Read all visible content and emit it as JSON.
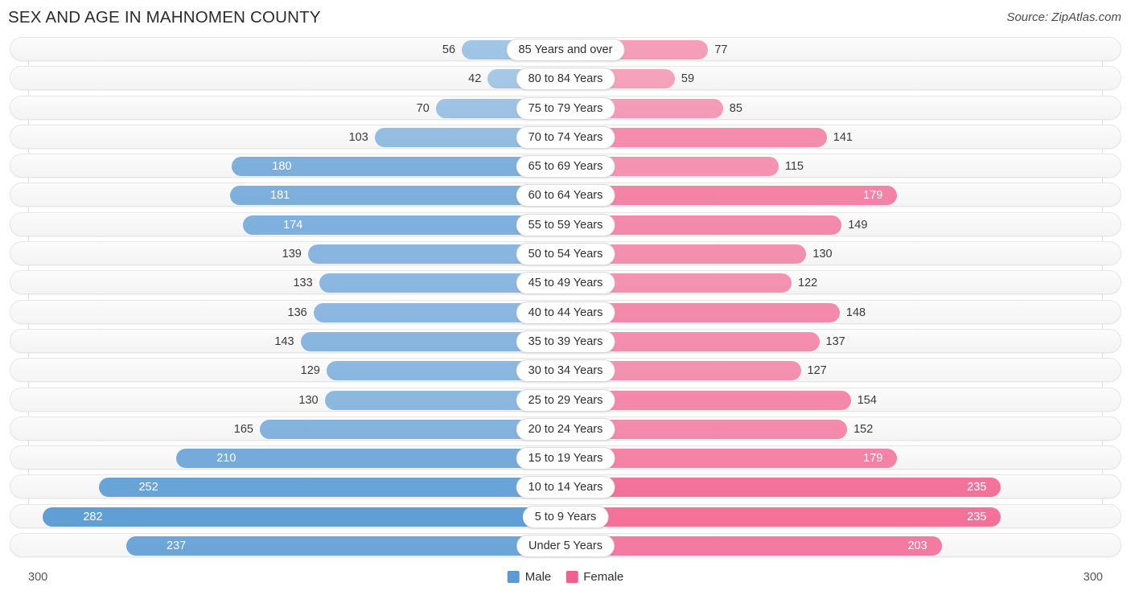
{
  "header": {
    "title": "SEX AND AGE IN MAHNOMEN COUNTY",
    "source": "Source: ZipAtlas.com"
  },
  "footer": {
    "axis_min_label": "300",
    "axis_max_label": "300",
    "legend": [
      {
        "label": "Male",
        "color": "#5b9bd5",
        "icon": "male-swatch"
      },
      {
        "label": "Female",
        "color": "#f2608e",
        "icon": "female-swatch"
      }
    ]
  },
  "chart_data": {
    "type": "bar",
    "subtype": "population-pyramid",
    "title": "SEX AND AGE IN MAHNOMEN COUNTY",
    "xlabel": "",
    "ylabel": "",
    "xlim": [
      300,
      300
    ],
    "axis_max": 300,
    "grid": true,
    "legend_position": "bottom-center",
    "categories": [
      "85 Years and over",
      "80 to 84 Years",
      "75 to 79 Years",
      "70 to 74 Years",
      "65 to 69 Years",
      "60 to 64 Years",
      "55 to 59 Years",
      "50 to 54 Years",
      "45 to 49 Years",
      "40 to 44 Years",
      "35 to 39 Years",
      "30 to 34 Years",
      "25 to 29 Years",
      "20 to 24 Years",
      "15 to 19 Years",
      "10 to 14 Years",
      "5 to 9 Years",
      "Under 5 Years"
    ],
    "series": [
      {
        "name": "Male",
        "color": "#5b9bd5",
        "side": "left",
        "values": [
          56,
          42,
          70,
          103,
          180,
          181,
          174,
          139,
          133,
          136,
          143,
          129,
          130,
          165,
          210,
          252,
          282,
          237
        ]
      },
      {
        "name": "Female",
        "color": "#f2608e",
        "side": "right",
        "values": [
          77,
          59,
          85,
          141,
          115,
          179,
          149,
          130,
          122,
          148,
          137,
          127,
          154,
          152,
          179,
          235,
          235,
          203
        ]
      }
    ]
  }
}
